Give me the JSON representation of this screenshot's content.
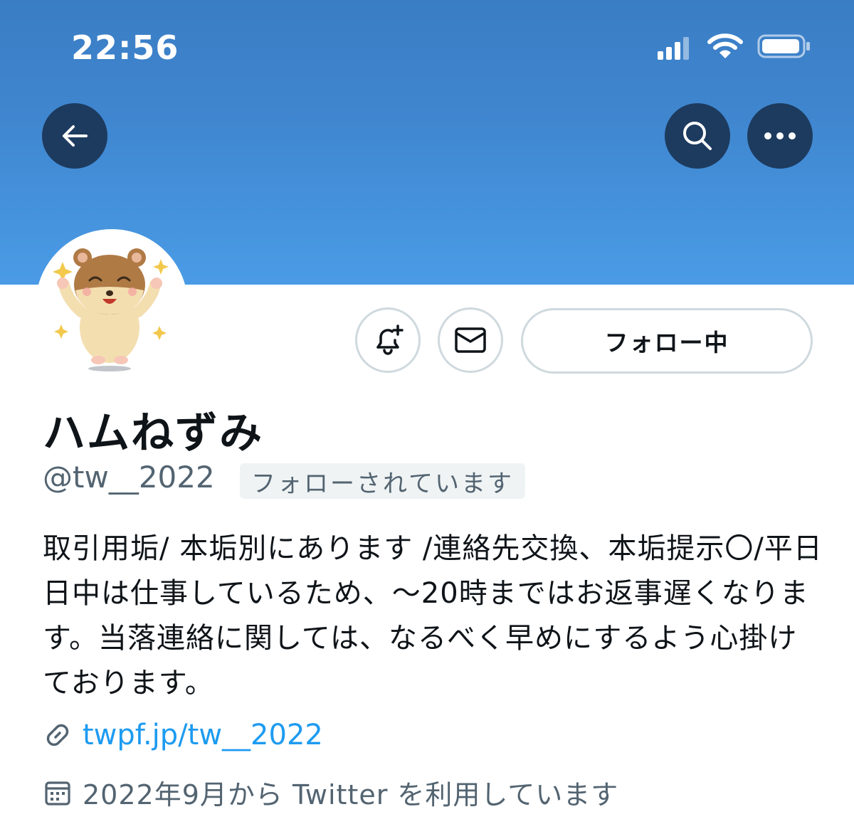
{
  "status_bar": {
    "time": "22:56",
    "signal_icon": "cellular-signal-icon",
    "wifi_icon": "wifi-icon",
    "battery_icon": "battery-icon"
  },
  "header": {
    "back_icon": "arrow-left-icon",
    "search_icon": "search-icon",
    "more_icon": "more-horizontal-icon",
    "banner_color": "#4a9be6"
  },
  "profile": {
    "avatar_icon": "hamster-avatar",
    "display_name": "ハムねずみ",
    "handle": "@tw__2022",
    "follows_you_badge": "フォローされています",
    "bio": "取引用垢/ 本垢別にあります /連絡先交換、本垢提示〇/平日日中は仕事しているため、〜20時まではお返事遅くなります。当落連絡に関しては、なるべく早めにするよう心掛けております。",
    "link_icon": "link-icon",
    "link": "twpf.jp/tw__2022",
    "calendar_icon": "calendar-icon",
    "joined": "2022年9月から Twitter を利用しています"
  },
  "actions": {
    "notify_icon": "bell-plus-icon",
    "message_icon": "envelope-icon",
    "follow_label": "フォロー中"
  },
  "colors": {
    "accent": "#1d9bf0",
    "header_button_bg": "#1d3b5f",
    "secondary_text": "#536471"
  }
}
